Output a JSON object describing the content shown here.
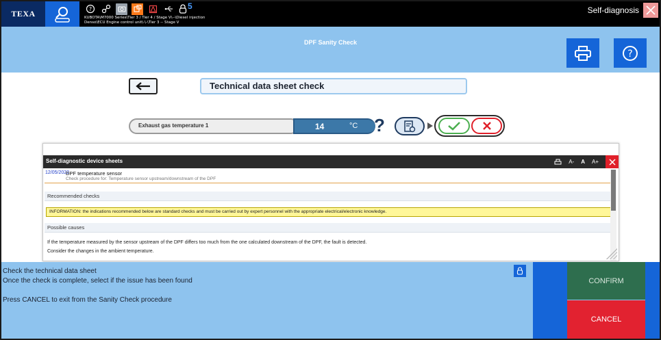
{
  "app": {
    "logo": "TEXA",
    "title": "Self-diagnosis",
    "lock_count": "5",
    "path_line1": "KUBOTA\\M7000 Series\\Tier 3 / Tier 4 / Stage V\\--\\Diesel injection",
    "path_line2": "Denso\\ECU Engine control unit\\-\\-\\Tier 3 -- Stage V"
  },
  "header": {
    "title": "DPF Sanity Check"
  },
  "check": {
    "title": "Technical data sheet check",
    "parameter_label": "Exhaust gas temperature 1",
    "parameter_value": "14",
    "parameter_unit": "°C",
    "help_glyph": "?"
  },
  "sheet": {
    "header": "Self-diagnostic device sheets",
    "tools": {
      "font_smaller": "A-",
      "font_normal": "A",
      "font_larger": "A+"
    },
    "entry": {
      "date": "12/05/2022",
      "name": "DPF temperature sensor",
      "subtitle": "Check procedure for: Temperature sensor upstream/downstream of the DPF"
    },
    "recommended_heading": "Recommended checks",
    "information": "INFORMATION: the indications recommended below are standard checks and must be carried out by expert personnel with the appropriate electrical/electronic knowledge.",
    "causes_heading": "Possible causes",
    "cause_lines": [
      "If the temperature measured by the sensor upstream of the DPF differs too much from the one calculated downstream of the DPF, the fault is detected.",
      "Consider the changes in the ambient temperature."
    ]
  },
  "bottom": {
    "line1": "Check the technical data sheet",
    "line2": "Once the check is complete, select if the issue has been found",
    "line3": "Press CANCEL to exit from the Sanity Check procedure",
    "confirm": "CONFIRM",
    "cancel": "CANCEL"
  },
  "colors": {
    "top_bar": "#000000",
    "logo_bg": "#0a2a63",
    "accent_blue": "#1565d8",
    "light_blue": "#8ec3ee",
    "confirm_green": "#2e6e4e",
    "cancel_red": "#e22230",
    "info_yellow": "#fff799"
  },
  "icons": [
    "user-scan-icon",
    "help-icon",
    "settings-link-icon",
    "camera-icon",
    "storage-icon",
    "warning-icon",
    "usb-icon",
    "lock-icon",
    "print-icon",
    "back-arrow-icon",
    "data-sheet-icon",
    "check-icon",
    "close-icon"
  ]
}
